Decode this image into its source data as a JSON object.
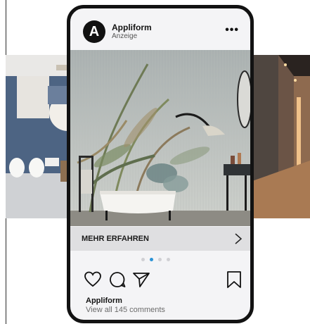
{
  "post": {
    "account_name": "Appliform",
    "sponsored_label": "Anzeige",
    "avatar_letter": "A",
    "more_glyph": "•••"
  },
  "cta": {
    "label": "MEHR ERFAHREN"
  },
  "carousel": {
    "total_slides": 4,
    "active_index": 1
  },
  "footer": {
    "owner": "Appliform",
    "comments_link": "View all 145 comments"
  },
  "icons": {
    "like": "heart-icon",
    "comment": "comment-icon",
    "share": "send-icon",
    "save": "bookmark-icon",
    "next": "chevron-right-icon"
  },
  "colors": {
    "active_dot": "#2a93d6",
    "cta_bg": "#dfdfe1",
    "frame": "#121212"
  }
}
